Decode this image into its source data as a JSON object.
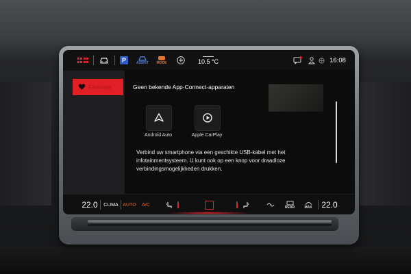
{
  "statusbar": {
    "icons": [
      "apps-grid-icon",
      "car-icon",
      "parking-icon",
      "assist-icon",
      "mode-icon",
      "add-icon",
      "message-icon",
      "user-icon",
      "sensor-icon"
    ],
    "parking_letter": "P",
    "assist_label": "ASSIST",
    "mode_label": "MODE",
    "temperature": "10.5 °C",
    "time": "16:08"
  },
  "sidebar": {
    "active_item": "Favoriete",
    "active_icon": "heart-icon"
  },
  "main": {
    "title": "Geen bekende App-Connect-apparaten",
    "tiles": [
      {
        "label": "Android Auto",
        "icon": "android-auto-icon"
      },
      {
        "label": "Apple CarPlay",
        "icon": "carplay-icon"
      }
    ],
    "description": "Verbind uw smartphone via een geschikte USB-kabel met het infotainmentsysteem. U kunt ook op een knop voor draadloze verbindingsmogelijkheden drukken."
  },
  "bottombar": {
    "temp_left": "22.0",
    "clima_label": "CLIMA",
    "auto_label": "AUTO",
    "ac_label": "A/C",
    "rear_label": "REAR",
    "max_label": "MAX",
    "temp_right": "22.0",
    "icons": [
      "seat-heat-left-icon",
      "home-icon",
      "seat-heat-right-icon",
      "fan-icon",
      "rear-defrost-icon",
      "front-defrost-icon"
    ]
  },
  "colors": {
    "accent_red": "#e3262f",
    "auto_orange": "#e26a2c",
    "screen_bg": "#0c0c0d",
    "sidebar_bg": "#1e1e20"
  }
}
